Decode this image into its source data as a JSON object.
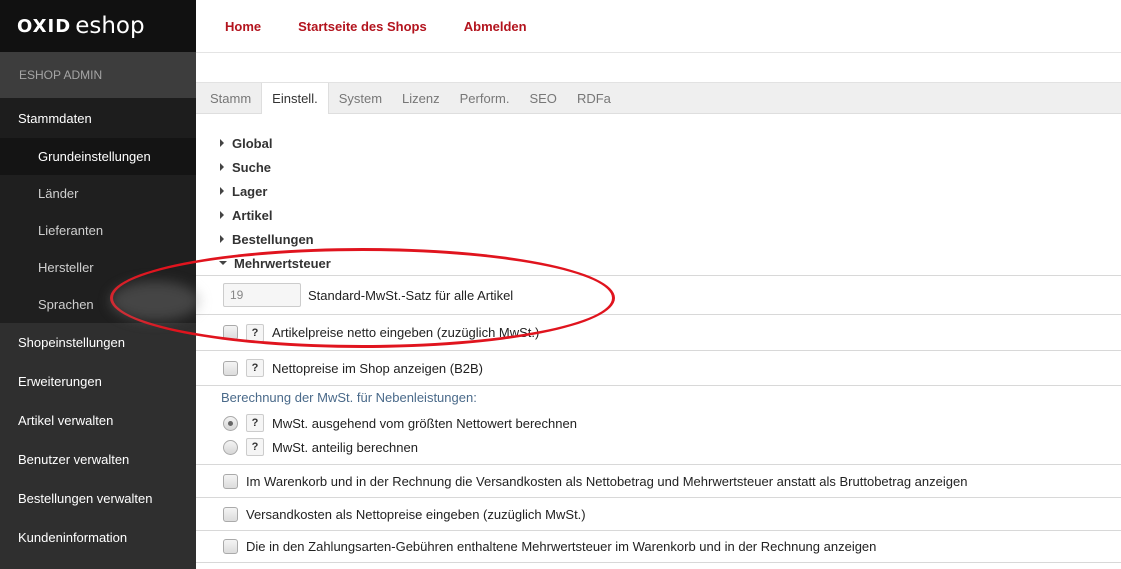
{
  "brand": {
    "logo_main": "OXID",
    "logo_sub": "eshop"
  },
  "sidebar": {
    "admin_label": "ESHOP ADMIN",
    "section_active": "Stammdaten",
    "sub_items": [
      "Grundeinstellungen",
      "Länder",
      "Lieferanten",
      "Hersteller",
      "Sprachen"
    ],
    "sections": [
      "Shopeinstellungen",
      "Erweiterungen",
      "Artikel verwalten",
      "Benutzer verwalten",
      "Bestellungen verwalten",
      "Kundeninformation"
    ]
  },
  "topnav": {
    "home": "Home",
    "shop_start": "Startseite des Shops",
    "logout": "Abmelden"
  },
  "tabs": [
    "Stamm",
    "Einstell.",
    "System",
    "Lizenz",
    "Perform.",
    "SEO",
    "RDFa"
  ],
  "groups": [
    "Global",
    "Suche",
    "Lager",
    "Artikel",
    "Bestellungen",
    "Mehrwertsteuer"
  ],
  "vat": {
    "default_rate_value": "19",
    "default_rate_label": "Standard-MwSt.-Satz für alle Artikel",
    "net_prices_entry": "Artikelpreise netto eingeben (zuzüglich MwSt.)",
    "net_prices_display": "Nettopreise im Shop anzeigen (B2B)",
    "side_costs_heading": "Berechnung der MwSt. für Nebenleistungen:",
    "radio_largest": "MwSt. ausgehend vom größten Nettowert berechnen",
    "radio_proportional": "MwSt. anteilig berechnen",
    "basket_shipping_net": "Im Warenkorb und in der Rechnung die Versandkosten als Nettobetrag und Mehrwertsteuer anstatt als Bruttobetrag anzeigen",
    "shipping_net_entry": "Versandkosten als Nettopreise eingeben (zuzüglich MwSt.)",
    "payment_fee_vat": "Die in den Zahlungsarten-Gebühren enthaltene Mehrwertsteuer im Warenkorb und in der Rechnung anzeigen"
  },
  "help_glyph": "?",
  "colors": {
    "accent": "#b3141e",
    "sidebar_bg": "#2f2f2f",
    "highlight": "#e0141e"
  }
}
